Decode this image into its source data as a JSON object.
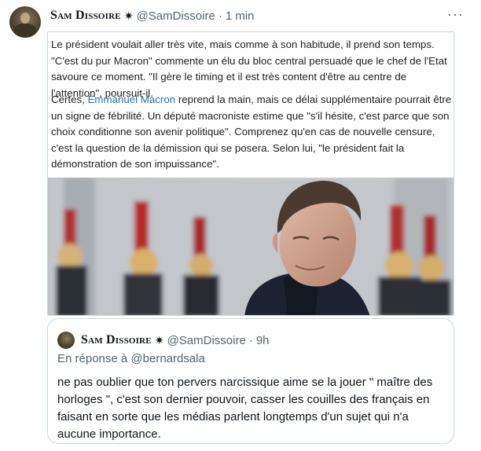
{
  "tweet": {
    "author_name": "Sam Dissoire",
    "author_badge": "✷",
    "author_handle": "@SamDissoire",
    "separator": "·",
    "time": "1 min",
    "more_label": "···",
    "card": {
      "paragraph1": "Le président voulait aller très vite, mais comme à son habitude, il prend son temps. \"C'est du pur Macron\" commente un élu du bloc central persuadé que le chef de l'Etat savoure ce moment. \"Il gère le timing et il est très content d'être au centre de l'attention\", poursuit-il.",
      "paragraph2_before_link": "Certes, ",
      "paragraph2_link": "Emmanuel Macron",
      "paragraph2_after_link": " reprend la main, mais ce délai supplémentaire pourrait être un signe de fébrilité. Un député macroniste estime que \"s'il hésite, c'est parce que son choix conditionne son avenir politique\". Comprenez qu'en cas de nouvelle censure, c'est la question de la démission qui se posera. Selon lui, \"le président fait la démonstration de son impuissance\"."
    }
  },
  "quote": {
    "author_name": "Sam Dissoire",
    "author_badge": "✷",
    "author_handle": "@SamDissoire",
    "separator": "·",
    "time": "9h",
    "reply_prefix": "En réponse à ",
    "reply_mention": "@bernardsala",
    "text": "ne pas oublier que ton pervers narcissique aime se la jouer \" maître des horloges \", c'est son dernier pouvoir, casser les couilles des français en faisant en sorte que les médias parlent longtemps d'un sujet qui n'a aucune importance."
  },
  "colors": {
    "link": "#1d6fbf",
    "secondary_text": "#536471",
    "border": "#cfd9de"
  }
}
